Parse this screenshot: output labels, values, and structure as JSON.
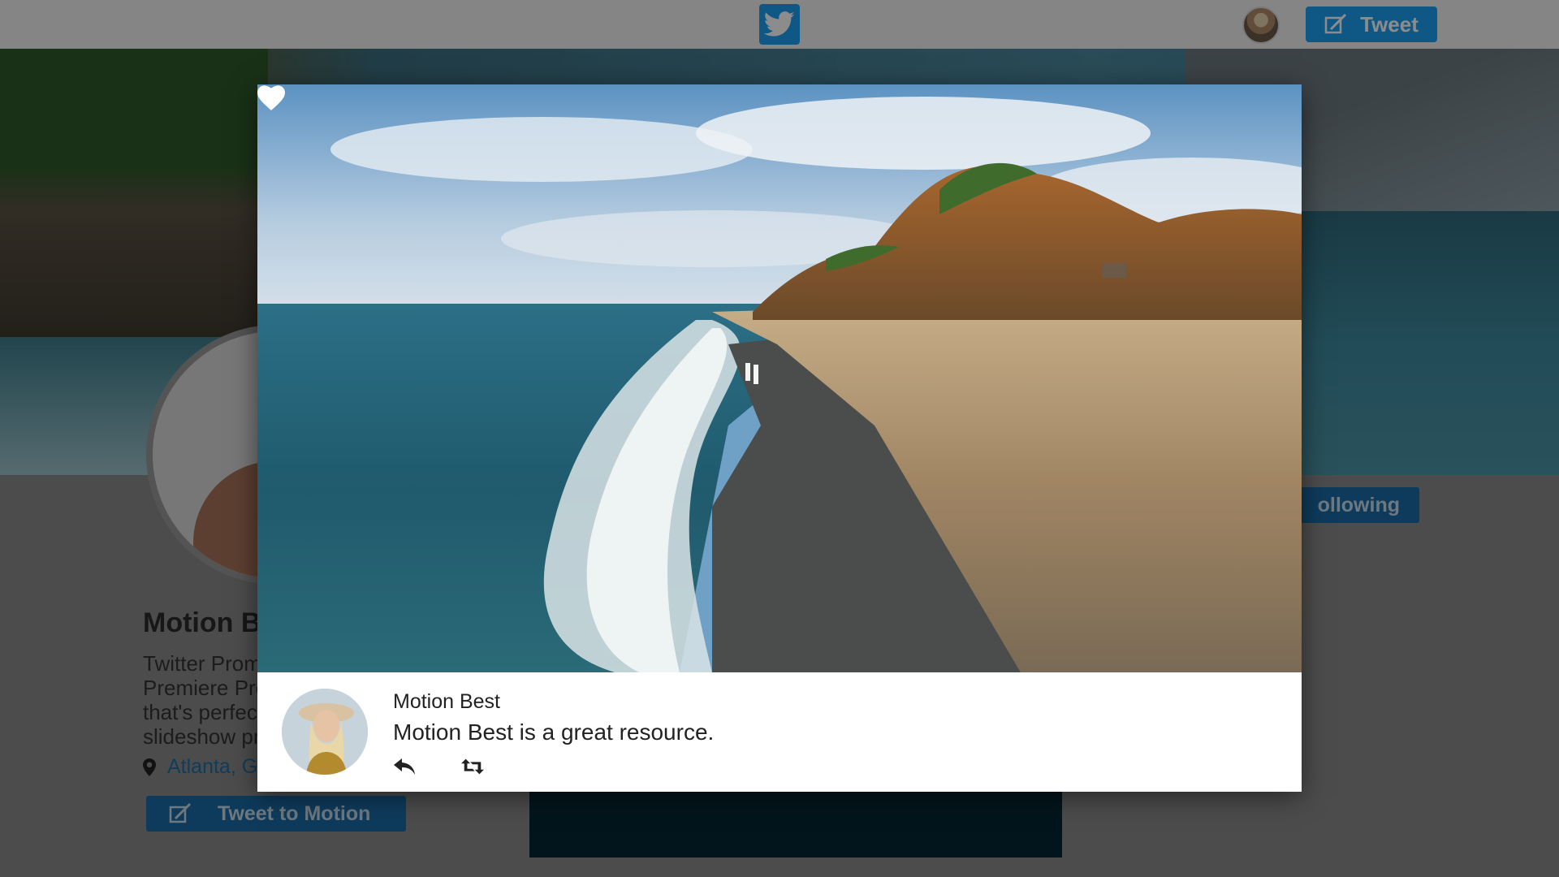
{
  "topbar": {
    "logo_icon": "twitter-bird-icon",
    "tweet_button_label": "Tweet"
  },
  "profile": {
    "name": "Motion B",
    "bio_lines": [
      "Twitter Prom",
      "Premiere Pro",
      "that's perfec",
      "slideshow pr"
    ],
    "location": "Atlanta, G",
    "tweet_to_label": "Tweet to Motion",
    "following_label": "ollowing"
  },
  "modal": {
    "heart_icon": "heart-icon",
    "author_name": "Motion Best",
    "tweet_text": "Motion Best is a great resource.",
    "actions": [
      {
        "name": "reply",
        "icon": "reply-icon"
      },
      {
        "name": "retweet",
        "icon": "retweet-icon"
      }
    ]
  },
  "colors": {
    "twitter_blue": "#1da1f2",
    "dim_overlay": "rgba(0,0,0,0.45)"
  }
}
